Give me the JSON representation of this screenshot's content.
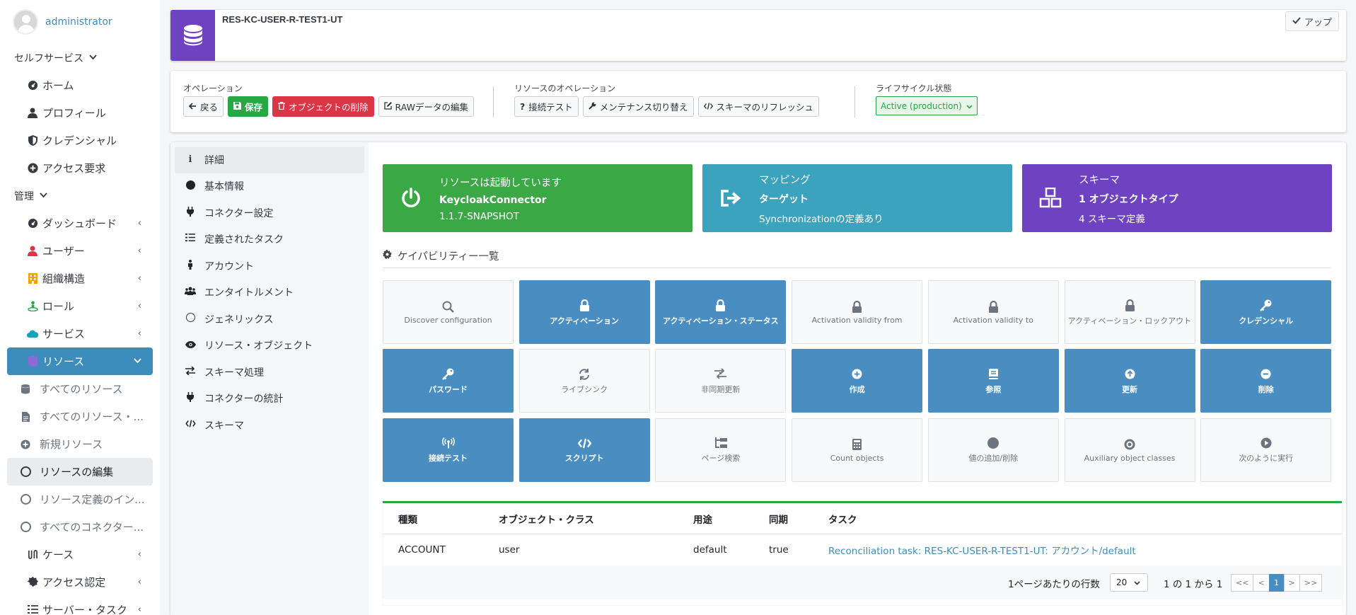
{
  "sidebar": {
    "user": "administrator",
    "self_service_header": "セルフサービス",
    "self_service_items": [
      {
        "label": "ホーム"
      },
      {
        "label": "プロフィール"
      },
      {
        "label": "クレデンシャル"
      },
      {
        "label": "アクセス要求"
      }
    ],
    "admin_header": "管理",
    "admin_items": [
      {
        "label": "ダッシュボード"
      },
      {
        "label": "ユーザー"
      },
      {
        "label": "組織構造"
      },
      {
        "label": "ロール"
      },
      {
        "label": "サービス"
      },
      {
        "label": "リソース"
      }
    ],
    "resource_sub_items": [
      {
        "label": "すべてのリソース"
      },
      {
        "label": "すべてのリソース・..."
      },
      {
        "label": "新規リソース"
      },
      {
        "label": "リソースの編集"
      },
      {
        "label": "リソース定義のイン..."
      },
      {
        "label": "すべてのコネクター..."
      }
    ],
    "more_items": [
      {
        "label": "ケース"
      },
      {
        "label": "アクセス認定"
      },
      {
        "label": "サーバー・タスク"
      }
    ],
    "colors": {
      "active": "#3c8dbc"
    }
  },
  "header": {
    "resource_name": "RES-KC-USER-R-TEST1-UT",
    "up_button": "アップ"
  },
  "operations": {
    "label": "オペレーション",
    "back": "戻る",
    "save": "保存",
    "delete": "オブジェクトの削除",
    "raw_edit": "RAWデータの編集",
    "resource_ops_label": "リソースのオペレーション",
    "test_connection": "接続テスト",
    "maintenance": "メンテナンス切り替え",
    "refresh_schema": "スキーマのリフレッシュ",
    "lifecycle_label": "ライフサイクル状態",
    "lifecycle_value": "Active (production)"
  },
  "tabs": [
    {
      "label": "詳細",
      "icon": "info-icon"
    },
    {
      "label": "基本情報",
      "icon": "circle-icon"
    },
    {
      "label": "コネクター設定",
      "icon": "plug-icon"
    },
    {
      "label": "定義されたタスク",
      "icon": "tasks-icon"
    },
    {
      "label": "アカウント",
      "icon": "male-icon"
    },
    {
      "label": "エンタイトルメント",
      "icon": "users-icon"
    },
    {
      "label": "ジェネリックス",
      "icon": "circle-outline-icon"
    },
    {
      "label": "リソース・オブジェクト",
      "icon": "eye-icon"
    },
    {
      "label": "スキーマ処理",
      "icon": "exchange-icon"
    },
    {
      "label": "コネクターの統計",
      "icon": "plug-icon"
    },
    {
      "label": "スキーマ",
      "icon": "code-icon"
    }
  ],
  "info_boxes": [
    {
      "title": "リソースは起動しています",
      "main": "KeycloakConnector",
      "sub": "1.1.7-SNAPSHOT",
      "color": "#3aa845",
      "icon": "power-icon"
    },
    {
      "title": "マッピング",
      "main": "ターゲット",
      "sub": "Synchronizationの定義あり",
      "color": "#3ba3bd",
      "icon": "sign-out-icon"
    },
    {
      "title": "スキーマ",
      "main": "1 オブジェクトタイプ",
      "sub": "4 スキーマ定義",
      "color": "#6f42c1",
      "icon": "cubes-icon"
    }
  ],
  "capabilities_header": "ケイパビリティー一覧",
  "capabilities": [
    {
      "label": "Discover configuration",
      "enabled": false,
      "icon": "search-icon"
    },
    {
      "label": "アクティベーション",
      "enabled": true,
      "icon": "lock-icon"
    },
    {
      "label": "アクティベーション・ステータス",
      "enabled": true,
      "icon": "lock-icon"
    },
    {
      "label": "Activation validity from",
      "enabled": false,
      "icon": "lock-icon"
    },
    {
      "label": "Activation validity to",
      "enabled": false,
      "icon": "lock-icon"
    },
    {
      "label": "アクティベーション・ロックアウト",
      "enabled": false,
      "icon": "lock-icon"
    },
    {
      "label": "クレデンシャル",
      "enabled": true,
      "icon": "key-icon"
    },
    {
      "label": "パスワード",
      "enabled": true,
      "icon": "key-icon"
    },
    {
      "label": "ライブシンク",
      "enabled": false,
      "icon": "sync-icon"
    },
    {
      "label": "非同期更新",
      "enabled": false,
      "icon": "async-icon"
    },
    {
      "label": "作成",
      "enabled": true,
      "icon": "plus-circle-icon"
    },
    {
      "label": "参照",
      "enabled": true,
      "icon": "book-icon"
    },
    {
      "label": "更新",
      "enabled": true,
      "icon": "arrow-up-circle-icon"
    },
    {
      "label": "削除",
      "enabled": true,
      "icon": "minus-circle-icon"
    },
    {
      "label": "接続テスト",
      "enabled": true,
      "icon": "broadcast-icon"
    },
    {
      "label": "スクリプト",
      "enabled": true,
      "icon": "code-icon"
    },
    {
      "label": "ページ検索",
      "enabled": false,
      "icon": "sitemap-icon"
    },
    {
      "label": "Count objects",
      "enabled": false,
      "icon": "calculator-icon"
    },
    {
      "label": "値の追加/削除",
      "enabled": false,
      "icon": "circle-icon"
    },
    {
      "label": "Auxiliary object classes",
      "enabled": false,
      "icon": "dot-circle-icon"
    },
    {
      "label": "次のように実行",
      "enabled": false,
      "icon": "play-circle-icon"
    }
  ],
  "table": {
    "headers": [
      "種類",
      "オブジェクト・クラス",
      "用途",
      "同期",
      "タスク"
    ],
    "rows": [
      [
        "ACCOUNT",
        "user",
        "default",
        "true",
        "Reconciliation task: RES-KC-USER-R-TEST1-UT: アカウント/default"
      ]
    ],
    "rows_per_page_label": "1ページあたりの行数",
    "rows_per_page": "20",
    "count": "1 の 1 から 1",
    "pager": [
      "<<",
      "<",
      "1",
      ">",
      ">>"
    ],
    "link_color": "#3c8dbc"
  }
}
